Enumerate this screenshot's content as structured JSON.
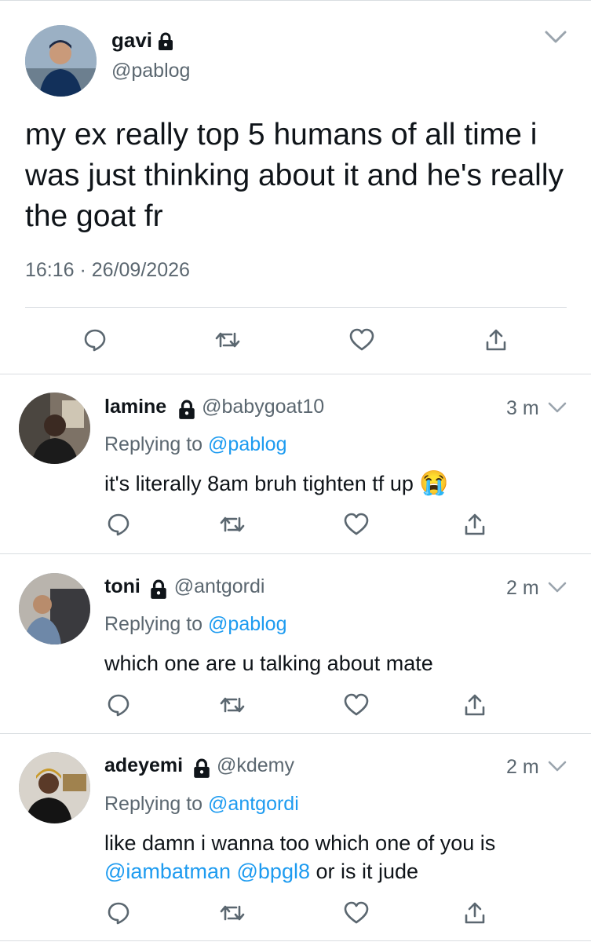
{
  "main_tweet": {
    "name": "gavi",
    "handle": "@pablog",
    "text": "my ex really top 5 humans of all time i was just thinking about it and he's really the goat fr",
    "timestamp": "16:16 · 26/09/2026",
    "icons": [
      "reply-icon",
      "retweet-icon",
      "like-icon",
      "share-icon",
      "chevron-down-icon",
      "lock-icon"
    ]
  },
  "replies": [
    {
      "name": "lamine",
      "handle": "@babygoat10",
      "time": "3 m",
      "replying_label": "Replying to",
      "replying_to": "@pablog",
      "text": "it's literally 8am bruh tighten tf up",
      "emoji": "😭"
    },
    {
      "name": "toni",
      "handle": "@antgordi",
      "time": "2 m",
      "replying_label": "Replying to",
      "replying_to": "@pablog",
      "text": "which one are u talking about mate"
    },
    {
      "name": "adeyemi",
      "handle": "@kdemy",
      "time": "2 m",
      "replying_label": "Replying to",
      "replying_to": "@antgordi",
      "text_line1": "like damn i wanna too which one of you is",
      "mention1": "@iambatman",
      "mention2": "@bpgl8",
      "text_tail": "or is it jude"
    }
  ],
  "colors": {
    "accent": "#1d9bf0",
    "text": "#0f1419",
    "secondary": "#5b6770",
    "divider": "#d9dde1"
  }
}
